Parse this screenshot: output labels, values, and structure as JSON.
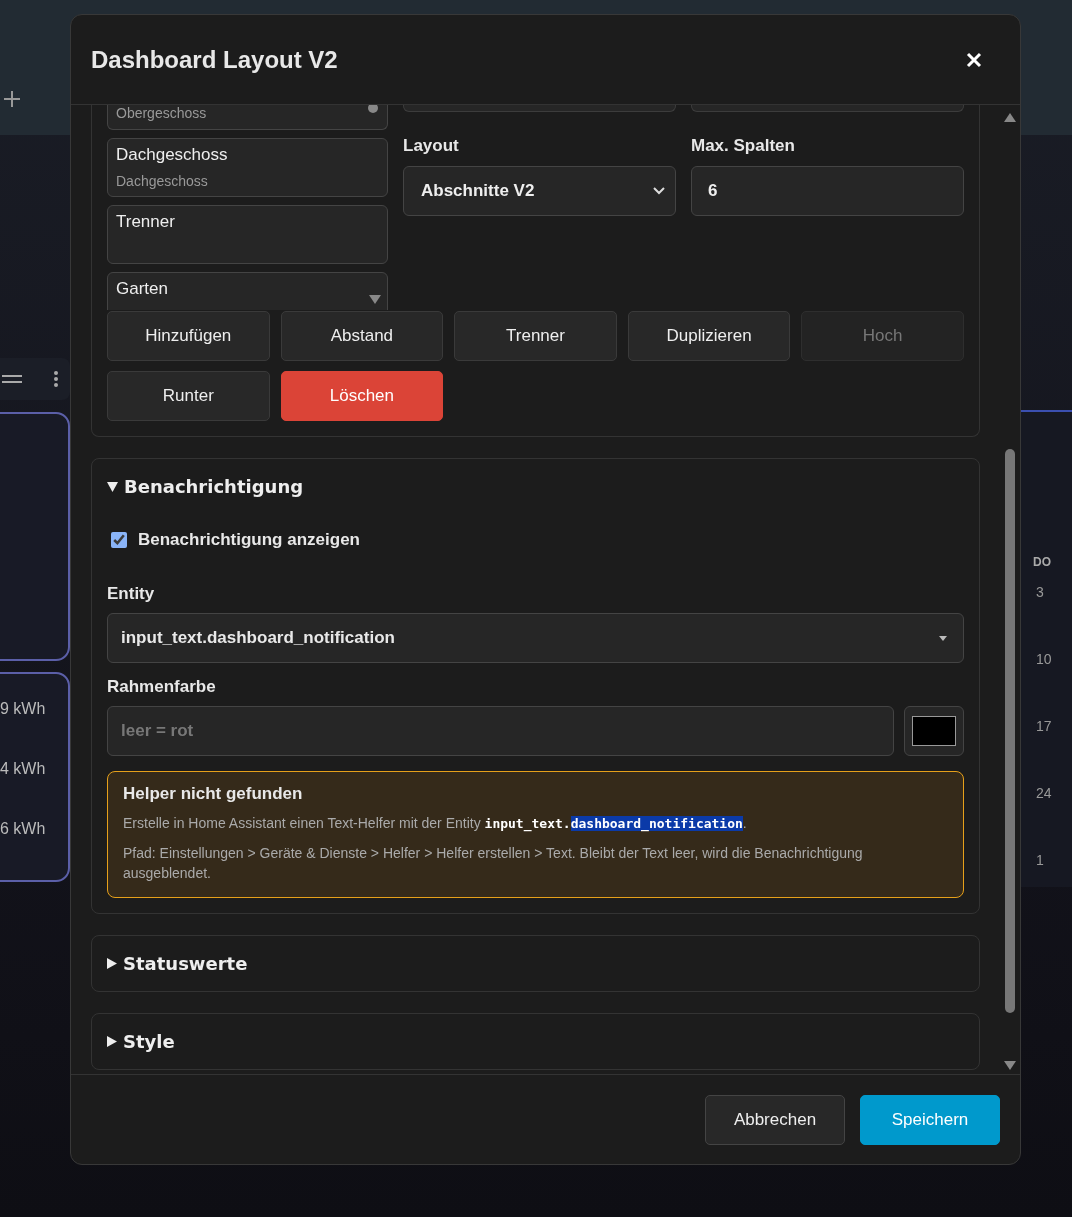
{
  "background": {
    "kwh_readings": [
      "9 kWh",
      "4 kWh",
      "6 kWh"
    ],
    "calendar": {
      "day_header": "DO",
      "days": [
        "3",
        "10",
        "17",
        "24",
        "1"
      ]
    }
  },
  "dialog": {
    "title": "Dashboard Layout V2",
    "sections_list": [
      {
        "subtitle": "Obergeschoss",
        "selected": false
      },
      {
        "title": "Dachgeschoss",
        "subtitle": "Dachgeschoss",
        "selected": false
      },
      {
        "title": "Trenner",
        "selected": false
      },
      {
        "title": "Garten",
        "selected": false
      }
    ],
    "layout": {
      "label": "Layout",
      "value": "Abschnitte V2"
    },
    "max_columns": {
      "label": "Max. Spalten",
      "value": "6"
    },
    "actions": [
      {
        "label": "Hinzufügen",
        "kind": "default",
        "disabled": false
      },
      {
        "label": "Abstand",
        "kind": "default",
        "disabled": false
      },
      {
        "label": "Trenner",
        "kind": "default",
        "disabled": false
      },
      {
        "label": "Duplizieren",
        "kind": "default",
        "disabled": false
      },
      {
        "label": "Hoch",
        "kind": "default",
        "disabled": true
      },
      {
        "label": "Runter",
        "kind": "default",
        "disabled": false
      },
      {
        "label": "Löschen",
        "kind": "danger",
        "disabled": false
      }
    ],
    "panels": [
      {
        "title": "Benachrichtigung",
        "expanded": true
      },
      {
        "title": "Statuswerte",
        "expanded": false
      },
      {
        "title": "Style",
        "expanded": false
      }
    ],
    "notification": {
      "checkbox": {
        "label": "Benachrichtigung anzeigen",
        "checked": true
      },
      "entity": {
        "label": "Entity",
        "value": "input_text.dashboard_notification"
      },
      "border_color": {
        "label": "Rahmenfarbe",
        "placeholder": "leer = rot",
        "color": "#000000"
      },
      "warning": {
        "title": "Helper nicht gefunden",
        "intro": "Erstelle in Home Assistant einen Text-Helfer mit der Entity",
        "code": [
          {
            "text": "input_text.",
            "selected": false
          },
          {
            "text": "dashboard_notification",
            "selected": true
          }
        ],
        "intro_end": ".",
        "path": "Pfad: Einstellungen > Geräte & Dienste > Helfer > Helfer erstellen > Text. Bleibt der Text leer, wird die Benachrichtigung ausgeblendet."
      }
    },
    "footer": [
      {
        "label": "Abbrechen",
        "kind": "secondary"
      },
      {
        "label": "Speichern",
        "kind": "primary"
      }
    ]
  }
}
